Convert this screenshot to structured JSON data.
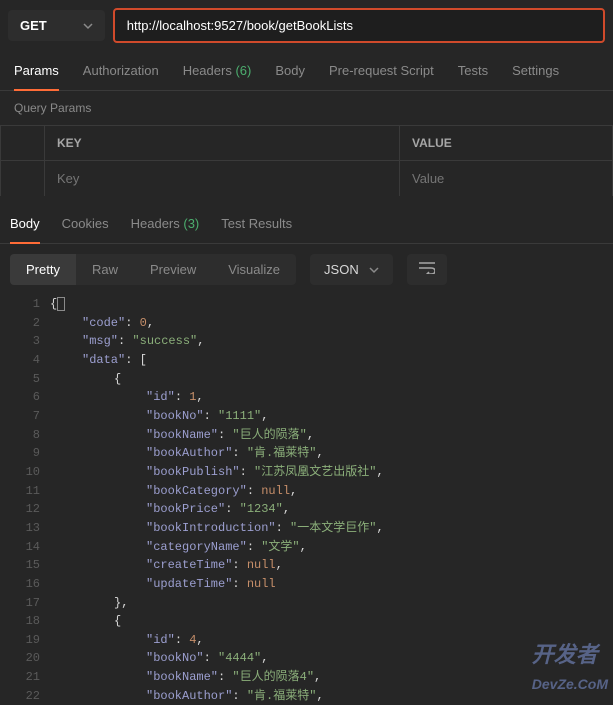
{
  "request": {
    "method": "GET",
    "url": "http://localhost:9527/book/getBookLists"
  },
  "main_tabs": {
    "params": "Params",
    "authorization": "Authorization",
    "headers": "Headers",
    "headers_count": "(6)",
    "body": "Body",
    "prerequest": "Pre-request Script",
    "tests": "Tests",
    "settings": "Settings"
  },
  "query_params_label": "Query Params",
  "params_table": {
    "key_header": "KEY",
    "value_header": "VALUE",
    "key_placeholder": "Key",
    "value_placeholder": "Value"
  },
  "response_tabs": {
    "body": "Body",
    "cookies": "Cookies",
    "headers": "Headers",
    "headers_count": "(3)",
    "test_results": "Test Results"
  },
  "view_tabs": {
    "pretty": "Pretty",
    "raw": "Raw",
    "preview": "Preview",
    "visualize": "Visualize"
  },
  "format_label": "JSON",
  "json_body": {
    "code": 0,
    "msg": "success",
    "data": [
      {
        "id": 1,
        "bookNo": "1111",
        "bookName": "巨人的陨落",
        "bookAuthor": "肯.福莱特",
        "bookPublish": "江苏凤凰文艺出版社",
        "bookCategory": null,
        "bookPrice": "1234",
        "bookIntroduction": "一本文学巨作",
        "categoryName": "文学",
        "createTime": null,
        "updateTime": null
      },
      {
        "id": 4,
        "bookNo": "4444",
        "bookName": "巨人的陨落4",
        "bookAuthor": "肯.福莱特"
      }
    ]
  },
  "watermark": "开发者",
  "watermark_domain": "DevZe.CoM"
}
